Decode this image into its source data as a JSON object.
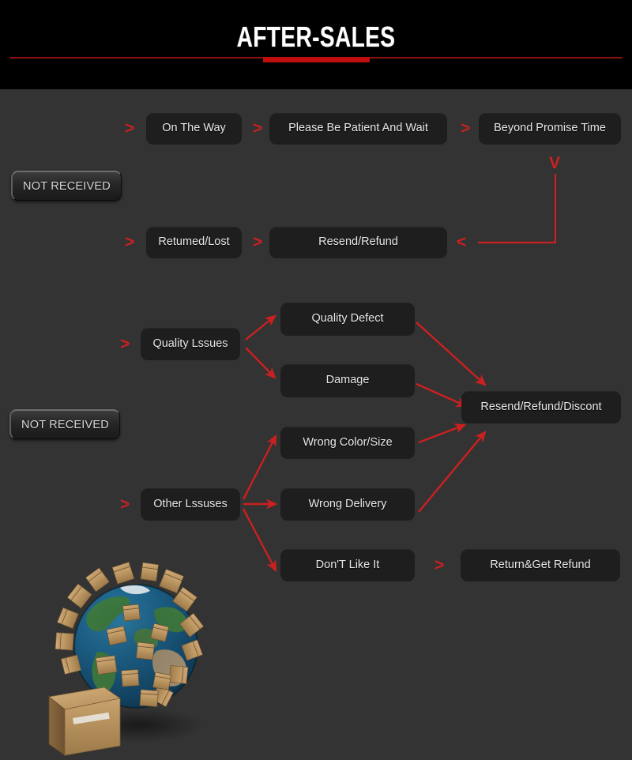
{
  "header": {
    "title": "AFTER-SALES",
    "accent_color": "#c00d0d",
    "background_color": "#000000"
  },
  "theme": {
    "page_background": "#333333",
    "box_background": "#1e1e1e",
    "arrow_color": "#cc2020",
    "text_color": "#e8e8e8"
  },
  "flow": {
    "not_received_buttons": [
      {
        "label": "NOT RECEIVED"
      },
      {
        "label": "NOT RECEIVED"
      }
    ],
    "rows": [
      {
        "name": "on-the-way-row",
        "boxes": [
          {
            "label": "On The Way"
          },
          {
            "label": "Please Be Patient And Wait"
          },
          {
            "label": "Beyond Promise Time"
          }
        ],
        "chevrons": [
          ">",
          ">",
          ">"
        ]
      },
      {
        "name": "returned-lost-row",
        "boxes": [
          {
            "label": "Retumed/Lost"
          },
          {
            "label": "Resend/Refund"
          }
        ],
        "chevrons": [
          ">",
          ">",
          "<"
        ]
      }
    ],
    "quality_issues": {
      "source": {
        "label": "Quality Lssues"
      },
      "chevron": ">",
      "branches": [
        {
          "label": "Quality Defect"
        },
        {
          "label": "Damage"
        }
      ]
    },
    "other_issues": {
      "source": {
        "label": "Other Lssuses"
      },
      "chevron": ">",
      "branches": [
        {
          "label": "Wrong Color/Size"
        },
        {
          "label": "Wrong Delivery"
        },
        {
          "label": "Don'T Like It"
        }
      ]
    },
    "outcomes": [
      {
        "name": "resend-refund-discont",
        "label": "Resend/Refund/Discont"
      },
      {
        "name": "return-get-refund",
        "label": "Return&Get Refund",
        "chevron": ">"
      }
    ],
    "down_chevron": "V"
  },
  "artwork": {
    "name": "globe-with-parcels-illustration",
    "description": "Earth globe covered in cardboard shipping boxes with a large parcel in front"
  }
}
